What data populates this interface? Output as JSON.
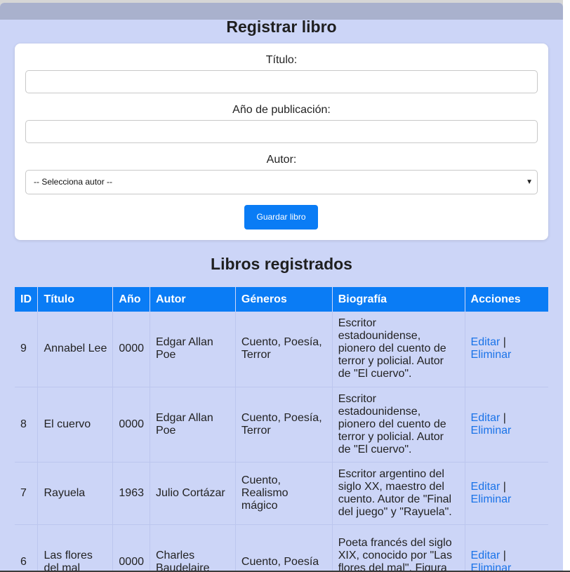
{
  "form": {
    "heading": "Registrar libro",
    "title_label": "Título:",
    "title_value": "",
    "year_label": "Año de publicación:",
    "year_value": "",
    "author_label": "Autor:",
    "author_selected": "-- Selecciona autor --",
    "submit_label": "Guardar libro"
  },
  "books": {
    "heading": "Libros registrados",
    "columns": [
      "ID",
      "Título",
      "Año",
      "Autor",
      "Géneros",
      "Biografía",
      "Acciones"
    ],
    "rows": [
      {
        "id": "9",
        "title": "Annabel Lee",
        "year": "0000",
        "author": "Edgar Allan Poe",
        "genres": "Cuento, Poesía, Terror",
        "bio": "Escritor estadounidense, pionero del cuento de terror y policial. Autor de \"El cuervo\".",
        "edit": "Editar",
        "sep": " |",
        "delete": "Eliminar"
      },
      {
        "id": "8",
        "title": "El cuervo",
        "year": "0000",
        "author": "Edgar Allan Poe",
        "genres": "Cuento, Poesía, Terror",
        "bio": "Escritor estadounidense, pionero del cuento de terror y policial. Autor de \"El cuervo\".",
        "edit": "Editar",
        "sep": " |",
        "delete": "Eliminar"
      },
      {
        "id": "7",
        "title": "Rayuela",
        "year": "1963",
        "author": "Julio Cortázar",
        "genres": "Cuento, Realismo mágico",
        "bio": "Escritor argentino del siglo XX, maestro del cuento. Autor de \"Final del juego\" y \"Rayuela\".",
        "edit": "Editar",
        "sep": " |",
        "delete": "Eliminar"
      },
      {
        "id": "6",
        "title": "Las flores del mal",
        "year": "0000",
        "author": "Charles Baudelaire",
        "genres": "Cuento, Poesía",
        "bio": "Poeta francés del siglo XIX, conocido por \"Las flores del mal\". Figura clave del simbolismo.",
        "edit": "Editar",
        "sep": " |",
        "delete": "Eliminar"
      }
    ]
  },
  "colors": {
    "accent": "#0a7cf5",
    "page_background": "#ccd5f7",
    "link": "#1a73e8"
  }
}
